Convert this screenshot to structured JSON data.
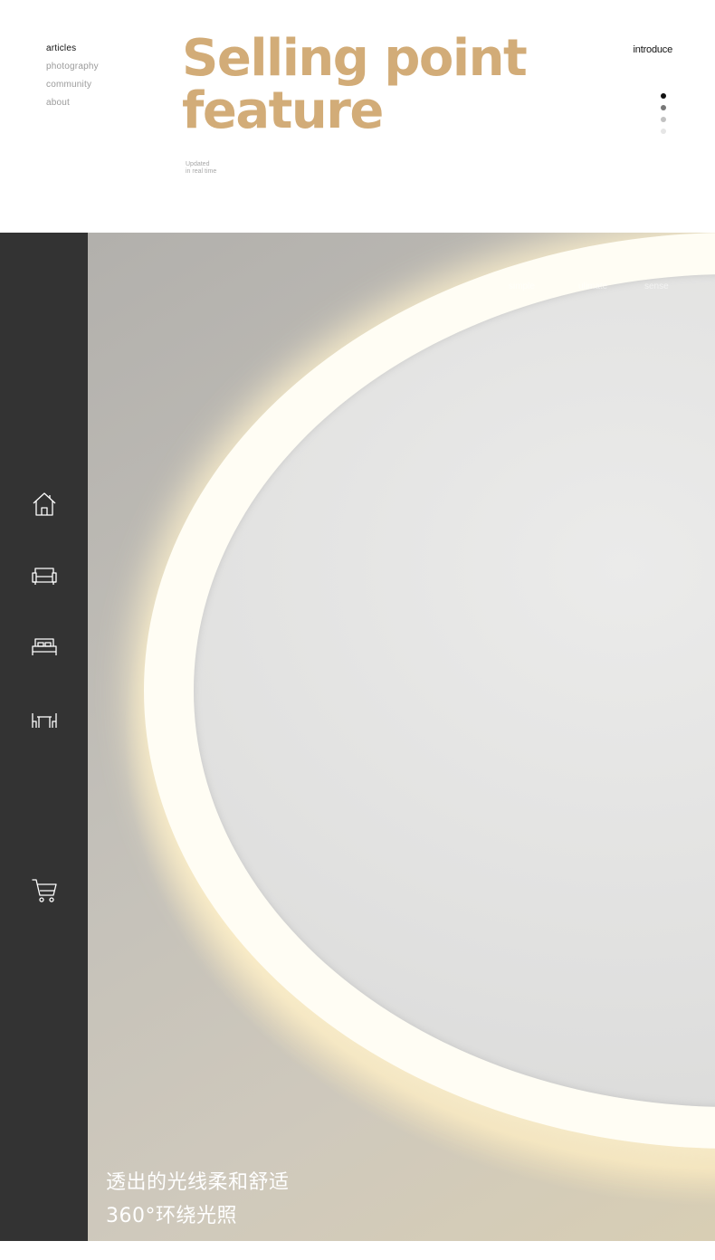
{
  "nav": {
    "items": [
      "articles",
      "photography",
      "community",
      "about"
    ],
    "active_index": 0
  },
  "headline": {
    "line1": "Selling point",
    "line2": "feature"
  },
  "updated": {
    "line1": "Updated",
    "line2": "in real time"
  },
  "introduce": "introduce",
  "pager": {
    "dot_colors": [
      "#111111",
      "#777777",
      "#c2c2c2",
      "#e6e6e6"
    ],
    "active_index": 0
  },
  "sidebar": {
    "icons": [
      "home-icon",
      "sofa-icon",
      "bed-icon",
      "dining-table-icon",
      "cart-icon"
    ]
  },
  "hero": {
    "watermarks": [
      "simple",
      "ulimate",
      "sense"
    ],
    "caption_line1": "透出的光线柔和舒适",
    "caption_line2": "360°环绕光照"
  },
  "colors": {
    "accent": "#d2ac78",
    "sidebar": "#333333",
    "text_dark": "#111111",
    "text_muted": "#9a9a9a"
  }
}
